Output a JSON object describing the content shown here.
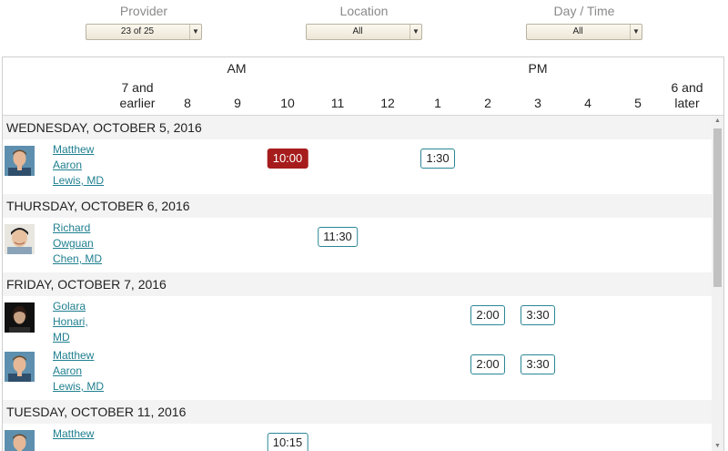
{
  "filters": {
    "provider": {
      "label": "Provider",
      "value": "23 of 25"
    },
    "location": {
      "label": "Location",
      "value": "All"
    },
    "daytime": {
      "label": "Day / Time",
      "value": "All"
    }
  },
  "header": {
    "am": "AM",
    "pm": "PM",
    "early": [
      "7 and",
      "earlier"
    ],
    "hours": [
      "8",
      "9",
      "10",
      "11",
      "12",
      "1",
      "2",
      "3",
      "4",
      "5"
    ],
    "late": [
      "6 and",
      "later"
    ]
  },
  "days": [
    {
      "date": "WEDNESDAY, OCTOBER 5, 2016",
      "providers": [
        {
          "name": [
            "Matthew",
            "Aaron",
            "Lewis, MD"
          ],
          "photo": "matthew",
          "slots": [
            {
              "time": "10:00",
              "col": 3,
              "selected": true
            },
            {
              "time": "1:30",
              "col": 6,
              "selected": false
            }
          ]
        }
      ]
    },
    {
      "date": "THURSDAY, OCTOBER 6, 2016",
      "providers": [
        {
          "name": [
            "Richard",
            "Owguan",
            "Chen, MD"
          ],
          "photo": "richard",
          "slots": [
            {
              "time": "11:30",
              "col": 4,
              "selected": false
            }
          ]
        }
      ]
    },
    {
      "date": "FRIDAY, OCTOBER 7, 2016",
      "providers": [
        {
          "name": [
            "Golara",
            "Honari,",
            "MD"
          ],
          "photo": "golara",
          "slots": [
            {
              "time": "2:00",
              "col": 7,
              "selected": false
            },
            {
              "time": "3:30",
              "col": 8,
              "selected": false
            }
          ]
        },
        {
          "name": [
            "Matthew",
            "Aaron",
            "Lewis, MD"
          ],
          "photo": "matthew",
          "slots": [
            {
              "time": "2:00",
              "col": 7,
              "selected": false
            },
            {
              "time": "3:30",
              "col": 8,
              "selected": false
            }
          ]
        }
      ]
    },
    {
      "date": "TUESDAY, OCTOBER 11, 2016",
      "providers": [
        {
          "name": [
            "Matthew"
          ],
          "photo": "matthew",
          "slots": [
            {
              "time": "10:15",
              "col": 3,
              "selected": false
            }
          ]
        }
      ]
    }
  ]
}
